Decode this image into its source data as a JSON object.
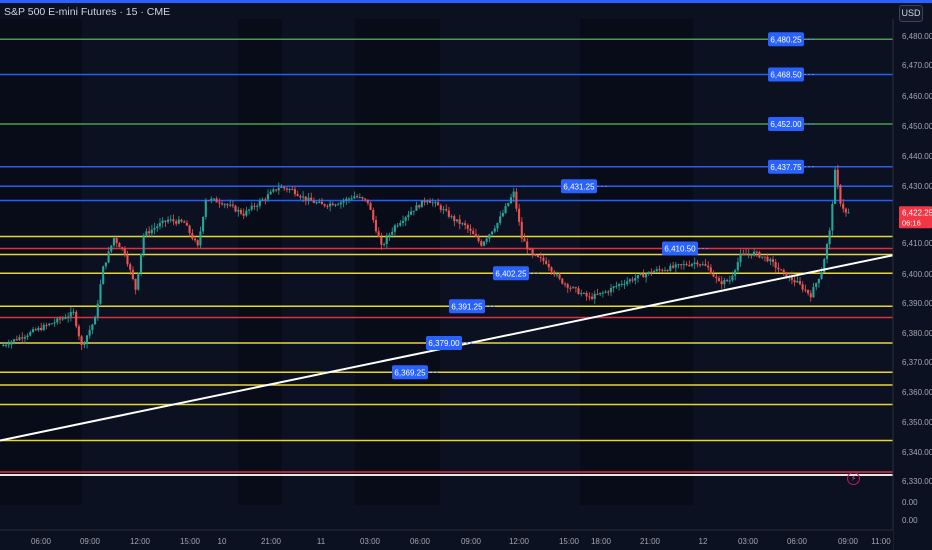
{
  "header": {
    "title": "S&P 500 E-mini Futures · 15 · CME",
    "currency_button": "USD"
  },
  "icons": {
    "alert": "lightning-icon"
  },
  "colors": {
    "background": "#0b1120",
    "night_band": "#060a14",
    "accent_blue": "#2962ff",
    "up_candle": "#26a69a",
    "down_candle": "#ef5350",
    "level_yellow": "#ffeb3b",
    "level_red": "#f23645",
    "level_green": "#4caf50",
    "level_blue": "#2962ff",
    "trendline": "#ffffff"
  },
  "chart_data": {
    "type": "candlestick",
    "symbol": "S&P 500 E-mini Futures",
    "interval": "15",
    "exchange": "CME",
    "ylim": [
      6325,
      6487
    ],
    "y_ticks": [
      "6,480.00",
      "6,470.00",
      "6,460.00",
      "6,450.00",
      "6,440.00",
      "6,430.00",
      "6,410.00",
      "6,400.00",
      "6,390.00",
      "6,380.00",
      "6,370.00",
      "6,360.00",
      "6,350.00",
      "6,340.00",
      "6,330.00",
      "0.00",
      "0.00"
    ],
    "x_ticks": [
      "06:00",
      "09:00",
      "12:00",
      "15:00",
      "10",
      "21:00",
      "11",
      "03:00",
      "06:00",
      "09:00",
      "12:00",
      "15:00",
      "18:00",
      "21:00",
      "12",
      "03:00",
      "06:00",
      "09:00",
      "11:00"
    ],
    "current_price": {
      "label": "6,422.25",
      "value": 6422.25,
      "countdown": "06:16"
    },
    "levels": [
      {
        "value": 6480.25,
        "color": "green",
        "label": "6,480.25"
      },
      {
        "value": 6468.5,
        "color": "blue",
        "label": "6,468.50"
      },
      {
        "value": 6452.0,
        "color": "green",
        "label": "6,452.00"
      },
      {
        "value": 6437.75,
        "color": "blue",
        "label": "6,437.75"
      },
      {
        "value": 6431.25,
        "color": "blue",
        "label": "6,431.25"
      },
      {
        "value": 6426.5,
        "color": "blue",
        "label": ""
      },
      {
        "value": 6414.5,
        "color": "yellow",
        "label": ""
      },
      {
        "value": 6410.5,
        "color": "red",
        "label": "6,410.50"
      },
      {
        "value": 6408.5,
        "color": "yellow",
        "label": ""
      },
      {
        "value": 6402.25,
        "color": "yellow",
        "label": "6,402.25"
      },
      {
        "value": 6391.25,
        "color": "yellow",
        "label": "6,391.25"
      },
      {
        "value": 6387.5,
        "color": "red",
        "label": ""
      },
      {
        "value": 6379.0,
        "color": "yellow",
        "label": "6,379.00"
      },
      {
        "value": 6369.25,
        "color": "yellow",
        "label": "6,369.25"
      },
      {
        "value": 6365.0,
        "color": "yellow",
        "label": ""
      },
      {
        "value": 6358.5,
        "color": "yellow",
        "label": ""
      },
      {
        "value": 6346.5,
        "color": "yellow",
        "label": ""
      },
      {
        "value": 6336.0,
        "color": "red",
        "label": ""
      },
      {
        "value": 6335.0,
        "color": "white",
        "label": ""
      }
    ],
    "trendline": {
      "from": {
        "bar": 0,
        "value": 6346.5
      },
      "to": {
        "bar": 311,
        "value": 6402.5
      }
    },
    "price_path": [
      [
        0,
        6378
      ],
      [
        10,
        6382
      ],
      [
        20,
        6386
      ],
      [
        27,
        6389
      ],
      [
        30,
        6378
      ],
      [
        35,
        6387
      ],
      [
        38,
        6404
      ],
      [
        42,
        6414
      ],
      [
        46,
        6409
      ],
      [
        50,
        6397
      ],
      [
        53,
        6415
      ],
      [
        58,
        6418
      ],
      [
        62,
        6420
      ],
      [
        68,
        6419
      ],
      [
        73,
        6411
      ],
      [
        76,
        6427
      ],
      [
        82,
        6426
      ],
      [
        90,
        6422
      ],
      [
        96,
        6426
      ],
      [
        103,
        6431
      ],
      [
        108,
        6430
      ],
      [
        113,
        6427
      ],
      [
        119,
        6425
      ],
      [
        126,
        6426
      ],
      [
        131,
        6428
      ],
      [
        136,
        6426
      ],
      [
        141,
        6411
      ],
      [
        146,
        6418
      ],
      [
        152,
        6423
      ],
      [
        158,
        6427
      ],
      [
        163,
        6424
      ],
      [
        168,
        6420
      ],
      [
        172,
        6418
      ],
      [
        178,
        6412
      ],
      [
        184,
        6419
      ],
      [
        190,
        6429
      ],
      [
        193,
        6414
      ],
      [
        197,
        6408
      ],
      [
        202,
        6406
      ],
      [
        207,
        6400
      ],
      [
        212,
        6397
      ],
      [
        218,
        6394
      ],
      [
        224,
        6396
      ],
      [
        230,
        6399
      ],
      [
        236,
        6401
      ],
      [
        242,
        6403
      ],
      [
        248,
        6404
      ],
      [
        253,
        6405
      ],
      [
        258,
        6406
      ],
      [
        262,
        6404
      ],
      [
        266,
        6399
      ],
      [
        270,
        6400
      ],
      [
        274,
        6408
      ],
      [
        279,
        6409
      ],
      [
        284,
        6407
      ],
      [
        290,
        6402
      ],
      [
        295,
        6399
      ],
      [
        300,
        6395
      ],
      [
        304,
        6403
      ],
      [
        307,
        6416
      ],
      [
        309,
        6436
      ],
      [
        311,
        6426
      ],
      [
        313,
        6422.25
      ]
    ]
  }
}
